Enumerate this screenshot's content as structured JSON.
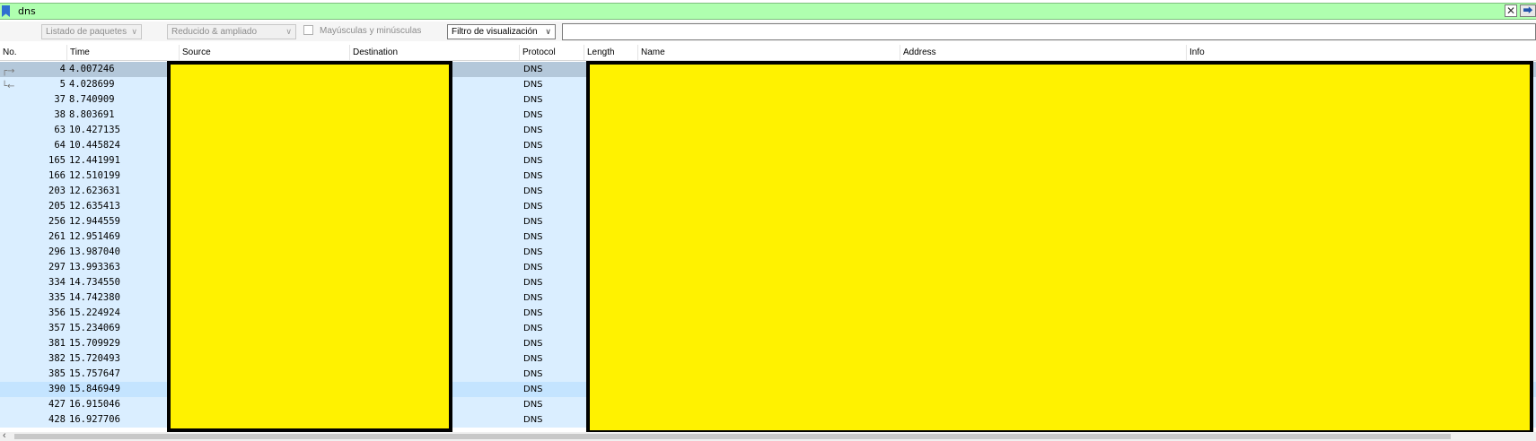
{
  "filter": {
    "text": "dns",
    "clear_glyph": "✕",
    "apply_glyph": "⮕"
  },
  "toolbar": {
    "packet_list_label": "Listado de paquetes",
    "view_mode_label": "Reducido & ampliado",
    "case_sensitive_label": "Mayúsculas y minúsculas",
    "case_sensitive_checked": false,
    "display_filter_label": "Filtro de visualización",
    "chevron": "∨",
    "search_value": ""
  },
  "columns": [
    "No.",
    "Time",
    "Source",
    "Destination",
    "Protocol",
    "Length",
    "Name",
    "Address",
    "Info"
  ],
  "packets": [
    {
      "no": "4",
      "time": "4.007246",
      "protocol": "DNS",
      "state": "selected",
      "marker": "┌→"
    },
    {
      "no": "5",
      "time": "4.028699",
      "protocol": "DNS",
      "state": "",
      "marker": "└←"
    },
    {
      "no": "37",
      "time": "8.740909",
      "protocol": "DNS",
      "state": "",
      "marker": ""
    },
    {
      "no": "38",
      "time": "8.803691",
      "protocol": "DNS",
      "state": "",
      "marker": ""
    },
    {
      "no": "63",
      "time": "10.427135",
      "protocol": "DNS",
      "state": "",
      "marker": ""
    },
    {
      "no": "64",
      "time": "10.445824",
      "protocol": "DNS",
      "state": "",
      "marker": ""
    },
    {
      "no": "165",
      "time": "12.441991",
      "protocol": "DNS",
      "state": "",
      "marker": ""
    },
    {
      "no": "166",
      "time": "12.510199",
      "protocol": "DNS",
      "state": "",
      "marker": ""
    },
    {
      "no": "203",
      "time": "12.623631",
      "protocol": "DNS",
      "state": "",
      "marker": ""
    },
    {
      "no": "205",
      "time": "12.635413",
      "protocol": "DNS",
      "state": "",
      "marker": ""
    },
    {
      "no": "256",
      "time": "12.944559",
      "protocol": "DNS",
      "state": "",
      "marker": ""
    },
    {
      "no": "261",
      "time": "12.951469",
      "protocol": "DNS",
      "state": "",
      "marker": ""
    },
    {
      "no": "296",
      "time": "13.987040",
      "protocol": "DNS",
      "state": "",
      "marker": ""
    },
    {
      "no": "297",
      "time": "13.993363",
      "protocol": "DNS",
      "state": "",
      "marker": ""
    },
    {
      "no": "334",
      "time": "14.734550",
      "protocol": "DNS",
      "state": "",
      "marker": ""
    },
    {
      "no": "335",
      "time": "14.742380",
      "protocol": "DNS",
      "state": "",
      "marker": ""
    },
    {
      "no": "356",
      "time": "15.224924",
      "protocol": "DNS",
      "state": "",
      "marker": ""
    },
    {
      "no": "357",
      "time": "15.234069",
      "protocol": "DNS",
      "state": "",
      "marker": ""
    },
    {
      "no": "381",
      "time": "15.709929",
      "protocol": "DNS",
      "state": "",
      "marker": ""
    },
    {
      "no": "382",
      "time": "15.720493",
      "protocol": "DNS",
      "state": "",
      "marker": ""
    },
    {
      "no": "385",
      "time": "15.757647",
      "protocol": "DNS",
      "state": "",
      "marker": ""
    },
    {
      "no": "390",
      "time": "15.846949",
      "protocol": "DNS",
      "state": "highlight",
      "marker": ""
    },
    {
      "no": "427",
      "time": "16.915046",
      "protocol": "DNS",
      "state": "",
      "marker": ""
    },
    {
      "no": "428",
      "time": "16.927706",
      "protocol": "DNS",
      "state": "",
      "marker": ""
    }
  ],
  "colors": {
    "filter_valid_bg": "#afffaf",
    "row_bg": "#daeeff",
    "row_selected_bg": "#b4c8da",
    "redaction": "#fff200"
  }
}
